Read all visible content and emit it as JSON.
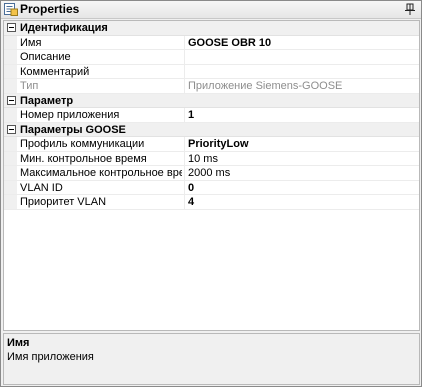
{
  "window": {
    "title": "Properties",
    "title_icon": "properties-icon",
    "pin_icon": "pin-icon"
  },
  "grid": {
    "categories": [
      {
        "label": "Идентификация",
        "properties": [
          {
            "name": "Имя",
            "value": "GOOSE OBR 10",
            "bold": true,
            "disabled": false
          },
          {
            "name": "Описание",
            "value": "",
            "bold": false,
            "disabled": false
          },
          {
            "name": "Комментарий",
            "value": "",
            "bold": false,
            "disabled": false
          },
          {
            "name": "Тип",
            "value": "Приложение Siemens-GOOSE",
            "bold": false,
            "disabled": true
          }
        ]
      },
      {
        "label": "Параметр",
        "properties": [
          {
            "name": "Номер приложения",
            "value": "1",
            "bold": true,
            "disabled": false
          }
        ]
      },
      {
        "label": "Параметры GOOSE",
        "properties": [
          {
            "name": "Профиль коммуникации",
            "value": "PriorityLow",
            "bold": true,
            "disabled": false
          },
          {
            "name": "Мин. контрольное время",
            "value": "10 ms",
            "bold": false,
            "disabled": false
          },
          {
            "name": "Максимальное контрольное время",
            "value": "2000 ms",
            "bold": false,
            "disabled": false
          },
          {
            "name": "VLAN ID",
            "value": "0",
            "bold": true,
            "disabled": false
          },
          {
            "name": "Приоритет VLAN",
            "value": "4",
            "bold": true,
            "disabled": false
          }
        ]
      }
    ]
  },
  "help": {
    "title": "Имя",
    "description": "Имя приложения"
  }
}
